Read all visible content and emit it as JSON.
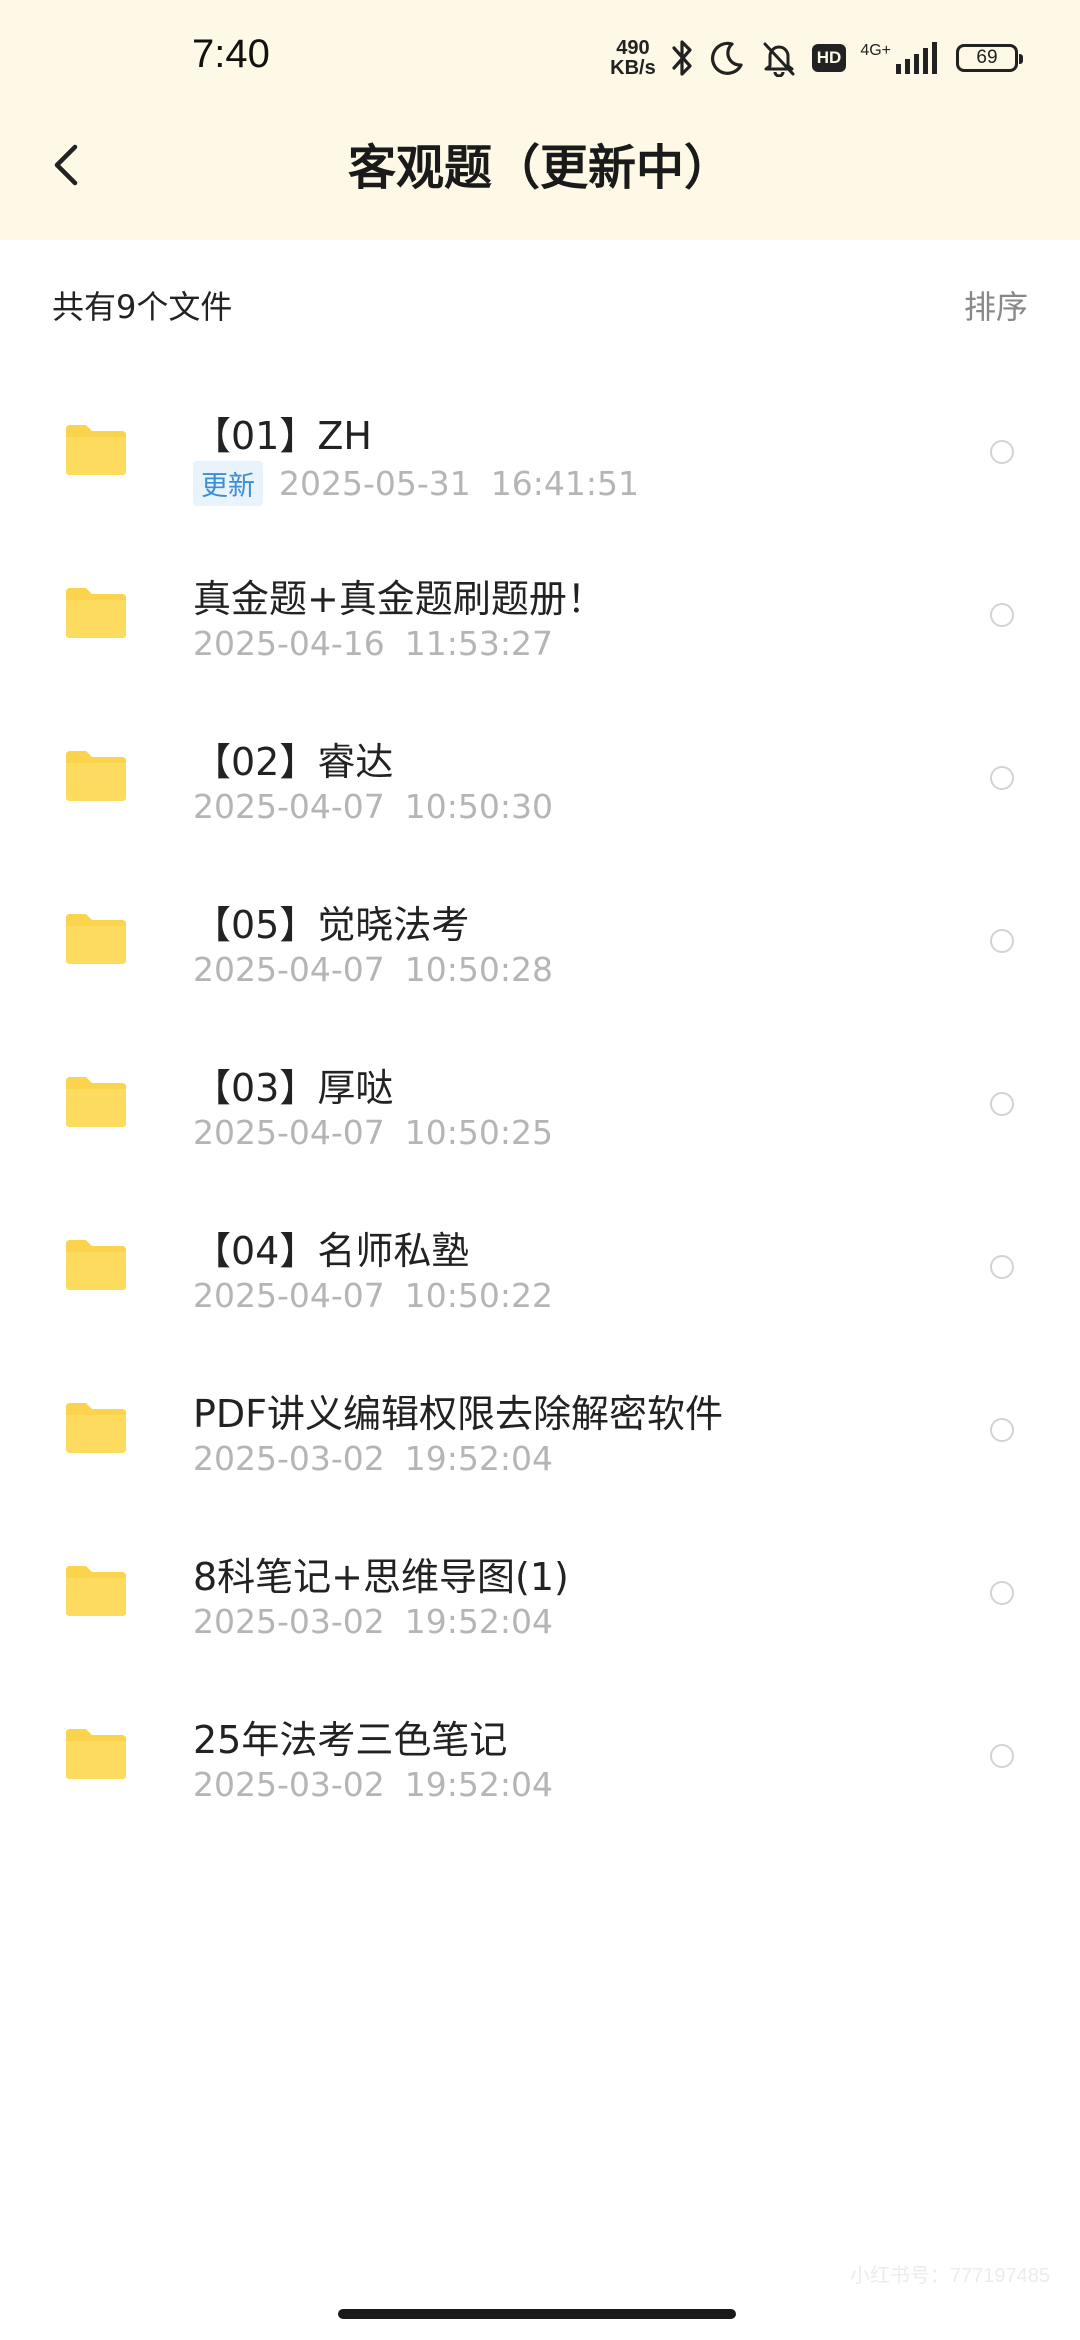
{
  "status_bar": {
    "time": "7:40",
    "net_speed_value": "490",
    "net_speed_unit": "KB/s",
    "hd_label": "HD",
    "network_label": "4G+",
    "battery_level": "69",
    "icons": [
      "bluetooth-icon",
      "moon-icon",
      "bell-off-icon",
      "hd-icon",
      "signal-icon",
      "battery-icon"
    ]
  },
  "header": {
    "title": "客观题（更新中）",
    "back_icon": "chevron-left-icon"
  },
  "summary": {
    "file_count": "共有9个文件",
    "sort_label": "排序"
  },
  "files": [
    {
      "name": "【01】ZH",
      "badge": "更新",
      "date": "2025-05-31",
      "time": "16:41:51"
    },
    {
      "name": "真金题+真金题刷题册！",
      "date": "2025-04-16",
      "time": "11:53:27"
    },
    {
      "name": "【02】睿达",
      "date": "2025-04-07",
      "time": "10:50:30"
    },
    {
      "name": "【05】觉晓法考",
      "date": "2025-04-07",
      "time": "10:50:28"
    },
    {
      "name": "【03】厚哒",
      "date": "2025-04-07",
      "time": "10:50:25"
    },
    {
      "name": "【04】名师私塾",
      "date": "2025-04-07",
      "time": "10:50:22"
    },
    {
      "name": "PDF讲义编辑权限去除解密软件",
      "date": "2025-03-02",
      "time": "19:52:04"
    },
    {
      "name": "8科笔记+思维导图(1)",
      "date": "2025-03-02",
      "time": "19:52:04"
    },
    {
      "name": "25年法考三色笔记",
      "date": "2025-03-02",
      "time": "19:52:04"
    }
  ],
  "colors": {
    "header_background": "#fdf9e6",
    "folder": "#fbd34d",
    "badge_text": "#3a8ed6",
    "meta_text": "#b5b5b5"
  },
  "watermark": "小红书号：777197485"
}
